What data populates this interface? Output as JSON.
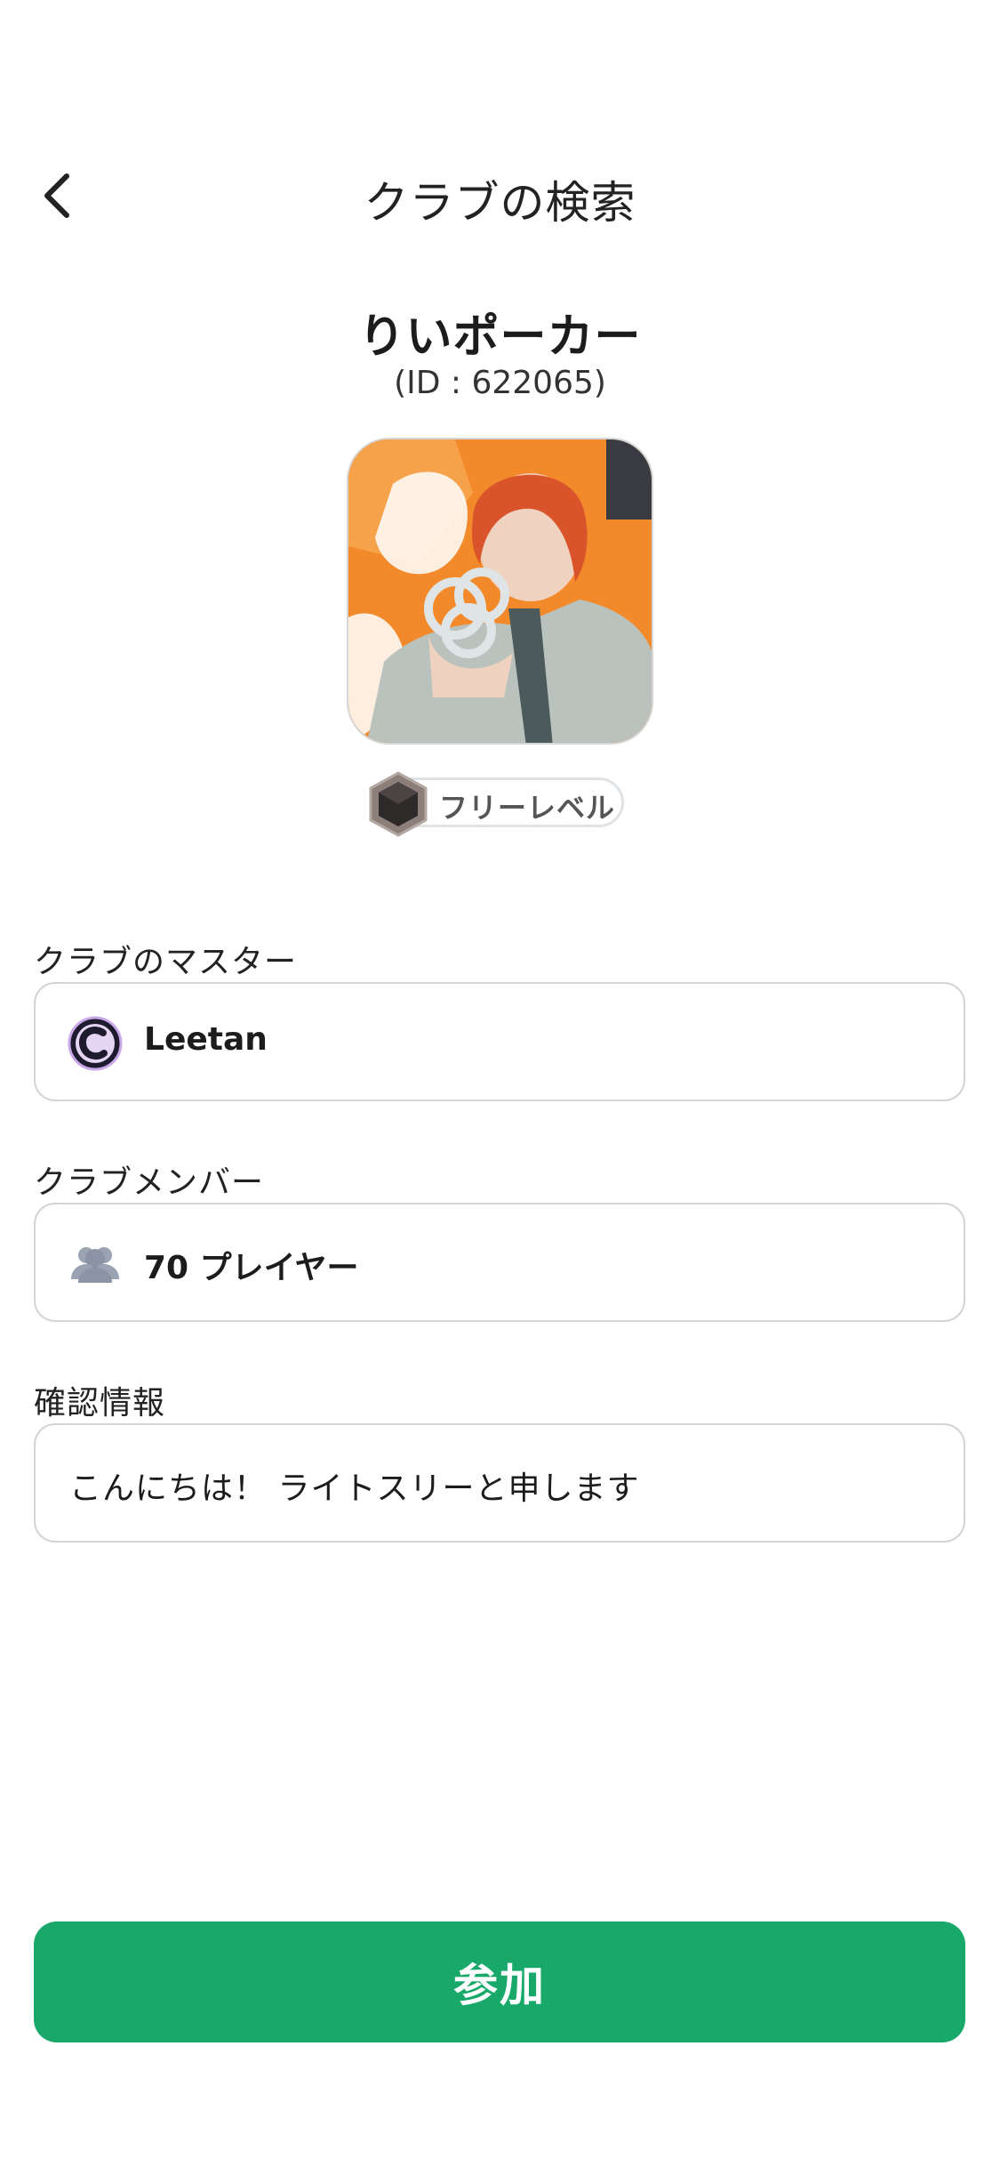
{
  "header": {
    "title": "クラブの検索",
    "back_icon": "chevron-left-icon"
  },
  "club": {
    "name": "りいポーカー",
    "id_text": "(ID : 622065)",
    "level": "フリーレベル"
  },
  "master": {
    "label": "クラブのマスター",
    "name": "Leetan",
    "icon": "club-logo-c-icon"
  },
  "members": {
    "label": "クラブメンバー",
    "value": "70 プレイヤー",
    "icon": "users-icon"
  },
  "verification": {
    "label": "確認情報",
    "value": "こんにちは！ ライトスリーと申します"
  },
  "join_button": {
    "label": "参加"
  },
  "colors": {
    "accent": "#18a96a",
    "avatar_bg": "#f28a2c"
  }
}
